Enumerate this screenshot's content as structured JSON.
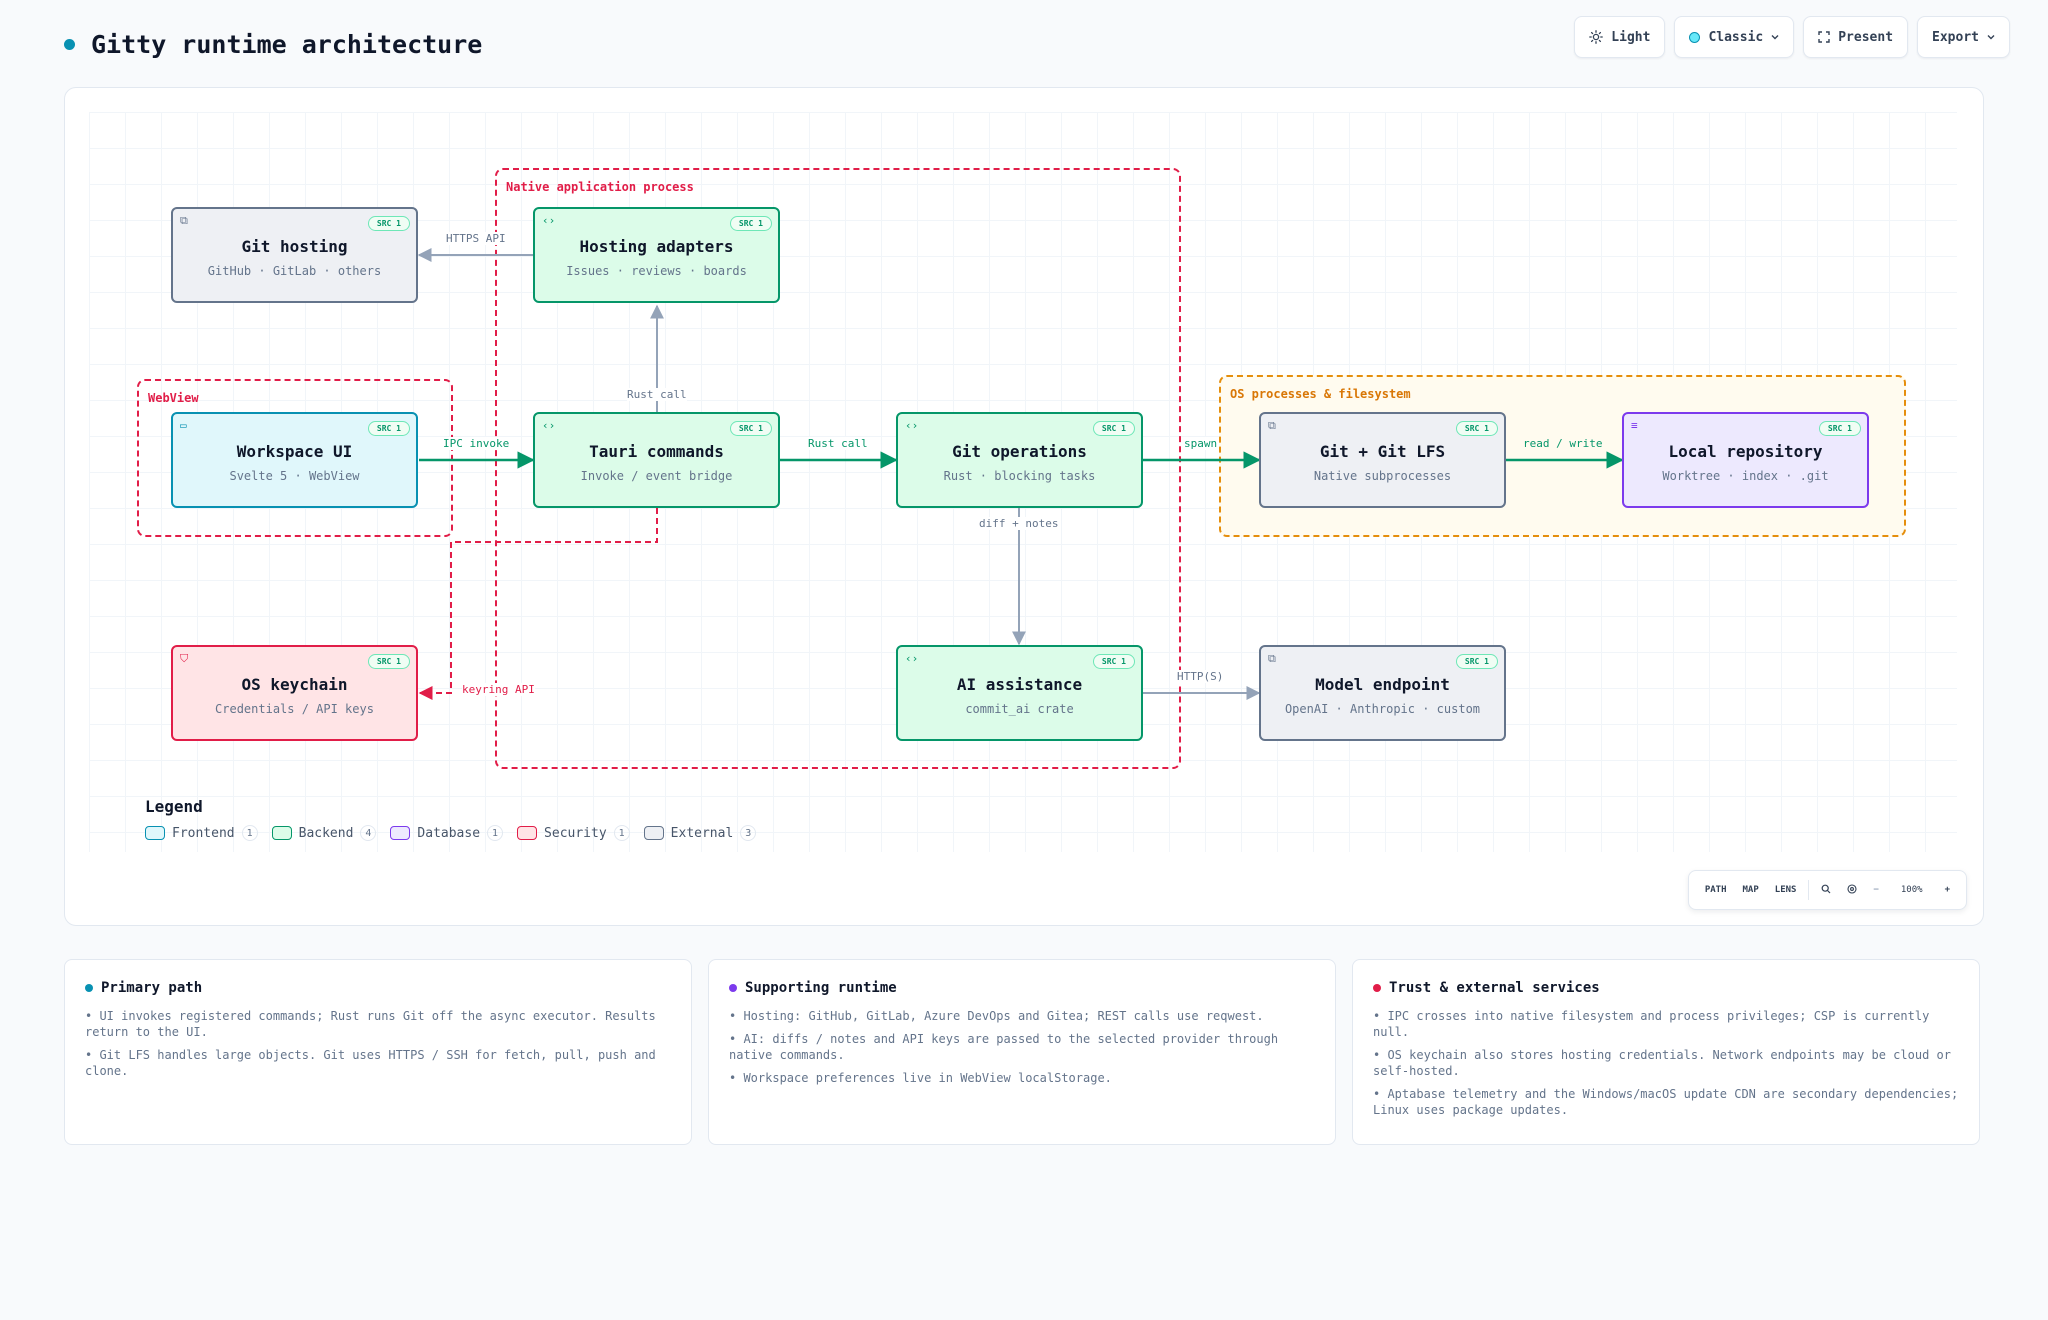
{
  "header": {
    "title": "Gitty runtime architecture",
    "accent": "#0891b2",
    "toolbar": {
      "light": "Light",
      "classic": "Classic",
      "present": "Present",
      "export": "Export"
    }
  },
  "diagram": {
    "groups": {
      "native": "Native application process",
      "webview": "WebView",
      "os": "OS processes & filesystem"
    },
    "nodes": {
      "git_hosting": {
        "title": "Git hosting",
        "sub": "GitHub · GitLab · others",
        "badge": "SRC 1",
        "icon": "external-link-icon"
      },
      "hosting_adapters": {
        "title": "Hosting adapters",
        "sub": "Issues · reviews · boards",
        "badge": "SRC 1",
        "icon": "code-icon"
      },
      "workspace_ui": {
        "title": "Workspace UI",
        "sub": "Svelte 5 · WebView",
        "badge": "SRC 1",
        "icon": "window-icon"
      },
      "tauri_commands": {
        "title": "Tauri commands",
        "sub": "Invoke / event bridge",
        "badge": "SRC 1",
        "icon": "code-icon"
      },
      "git_operations": {
        "title": "Git operations",
        "sub": "Rust · blocking tasks",
        "badge": "SRC 1",
        "icon": "code-icon"
      },
      "git_lfs": {
        "title": "Git + Git LFS",
        "sub": "Native subprocesses",
        "badge": "SRC 1",
        "icon": "external-link-icon"
      },
      "local_repo": {
        "title": "Local repository",
        "sub": "Worktree · index · .git",
        "badge": "SRC 1",
        "icon": "database-icon"
      },
      "os_keychain": {
        "title": "OS keychain",
        "sub": "Credentials / API keys",
        "badge": "SRC 1",
        "icon": "shield-icon"
      },
      "ai_assistance": {
        "title": "AI assistance",
        "sub": "commit_ai crate",
        "badge": "SRC 1",
        "icon": "code-icon"
      },
      "model_endpoint": {
        "title": "Model endpoint",
        "sub": "OpenAI · Anthropic · custom",
        "badge": "SRC 1",
        "icon": "external-link-icon"
      }
    },
    "edges": {
      "https_api": "HTTPS API",
      "rust_call_up": "Rust call",
      "ipc_invoke": "IPC invoke",
      "rust_call": "Rust call",
      "spawn": "spawn",
      "read_write": "read / write",
      "diff_notes": "diff + notes",
      "http_s": "HTTP(S)",
      "keyring_api": "keyring API"
    },
    "legend": {
      "title": "Legend",
      "items": [
        {
          "label": "Frontend",
          "count": "1"
        },
        {
          "label": "Backend",
          "count": "4"
        },
        {
          "label": "Database",
          "count": "1"
        },
        {
          "label": "Security",
          "count": "1"
        },
        {
          "label": "External",
          "count": "3"
        }
      ]
    },
    "colors": {
      "frontend": "#0891b2",
      "backend": "#059669",
      "database": "#7c3aed",
      "security": "#e11d48",
      "external": "#64748b",
      "os_group": "#f59e0b"
    }
  },
  "controls": {
    "path": "PATH",
    "map": "MAP",
    "lens": "LENS",
    "minus": "−",
    "zoom": "100%",
    "plus": "+"
  },
  "cards": [
    {
      "title": "Primary path",
      "dot": "#0891b2",
      "items": [
        "• UI invokes registered commands; Rust runs Git off the async executor. Results return to the UI.",
        "• Git LFS handles large objects. Git uses HTTPS / SSH for fetch, pull, push and clone."
      ]
    },
    {
      "title": "Supporting runtime",
      "dot": "#7c3aed",
      "items": [
        "• Hosting: GitHub, GitLab, Azure DevOps and Gitea; REST calls use reqwest.",
        "• AI: diffs / notes and API keys are passed to the selected provider through native commands.",
        "• Workspace preferences live in WebView localStorage."
      ]
    },
    {
      "title": "Trust & external services",
      "dot": "#e11d48",
      "items": [
        "• IPC crosses into native filesystem and process privileges; CSP is currently null.",
        "• OS keychain also stores hosting credentials. Network endpoints may be cloud or self-hosted.",
        "• Aptabase telemetry and the Windows/macOS update CDN are secondary dependencies; Linux uses package updates."
      ]
    }
  ]
}
